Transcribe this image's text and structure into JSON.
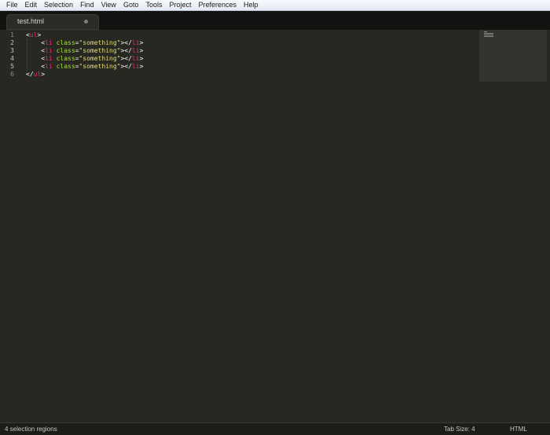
{
  "menu": [
    "File",
    "Edit",
    "Selection",
    "Find",
    "View",
    "Goto",
    "Tools",
    "Project",
    "Preferences",
    "Help"
  ],
  "tab": {
    "label": "test.html",
    "dirty_icon": "dirty-dot-icon"
  },
  "editor": {
    "line_numbers": [
      "1",
      "2",
      "3",
      "4",
      "5",
      "6"
    ],
    "lines": [
      [
        {
          "t": "<",
          "c": "punct"
        },
        {
          "t": "ul",
          "c": "tag"
        },
        {
          "t": ">",
          "c": "punct"
        }
      ],
      [
        {
          "t": "    <",
          "c": "punct"
        },
        {
          "t": "li",
          "c": "tag"
        },
        {
          "t": " ",
          "c": "punct"
        },
        {
          "t": "class",
          "c": "attr"
        },
        {
          "t": "=",
          "c": "punct"
        },
        {
          "t": "\"something\"",
          "c": "str"
        },
        {
          "t": "></",
          "c": "punct"
        },
        {
          "t": "li",
          "c": "tag"
        },
        {
          "t": ">",
          "c": "punct"
        }
      ],
      [
        {
          "t": "    <",
          "c": "punct"
        },
        {
          "t": "li",
          "c": "tag"
        },
        {
          "t": " ",
          "c": "punct"
        },
        {
          "t": "class",
          "c": "attr"
        },
        {
          "t": "=",
          "c": "punct"
        },
        {
          "t": "\"something\"",
          "c": "str"
        },
        {
          "t": "></",
          "c": "punct"
        },
        {
          "t": "li",
          "c": "tag"
        },
        {
          "t": ">",
          "c": "punct"
        }
      ],
      [
        {
          "t": "    <",
          "c": "punct"
        },
        {
          "t": "li",
          "c": "tag"
        },
        {
          "t": " ",
          "c": "punct"
        },
        {
          "t": "class",
          "c": "attr"
        },
        {
          "t": "=",
          "c": "punct"
        },
        {
          "t": "\"something\"",
          "c": "str"
        },
        {
          "t": "></",
          "c": "punct"
        },
        {
          "t": "li",
          "c": "tag"
        },
        {
          "t": ">",
          "c": "punct"
        }
      ],
      [
        {
          "t": "    <",
          "c": "punct"
        },
        {
          "t": "li",
          "c": "tag"
        },
        {
          "t": " ",
          "c": "punct"
        },
        {
          "t": "class",
          "c": "attr"
        },
        {
          "t": "=",
          "c": "punct"
        },
        {
          "t": "\"something\"",
          "c": "str"
        },
        {
          "t": "></",
          "c": "punct"
        },
        {
          "t": "li",
          "c": "tag"
        },
        {
          "t": ">",
          "c": "punct"
        }
      ],
      [
        {
          "t": "</",
          "c": "punct"
        },
        {
          "t": "ul",
          "c": "tag"
        },
        {
          "t": ">",
          "c": "punct"
        }
      ]
    ],
    "cursor_lines": [
      2,
      3,
      4,
      5
    ],
    "colors": {
      "background": "#272822",
      "tag": "#f92672",
      "attribute": "#a6e22e",
      "string": "#e6db74",
      "text": "#f8f8f2"
    }
  },
  "status": {
    "selection": "4 selection regions",
    "tab_size": "Tab Size: 4",
    "syntax": "HTML"
  }
}
